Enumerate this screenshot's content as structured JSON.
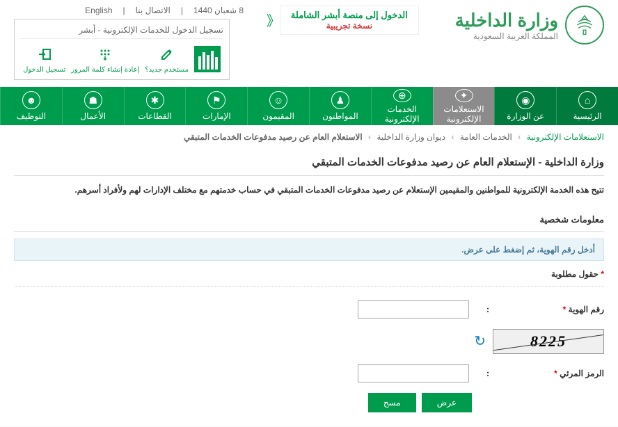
{
  "header": {
    "ministry_title": "وزارة الداخلية",
    "ministry_sub": "المملكة العربية السعودية",
    "banner_title": "الدخول إلى منصة أبشر الشاملة",
    "banner_sub": "نسخة تجريبية",
    "date_text": "8 شعبان 1440",
    "contact": "الاتصال بنا",
    "lang": "English"
  },
  "absher": {
    "title": "تسجيل الدخول للخدمات الإلكترونية - أبشر",
    "login": "تسجيل الدخول",
    "reset": "إعادة إنشاء كلمة المرور",
    "newuser": "مستخدم جديد؟"
  },
  "nav": {
    "home": "الرئيسية",
    "about": "عن الوزارة",
    "inquiry": "الاستعلامات الإلكترونية",
    "eservices": "الخدمات الإلكترونية",
    "citizens": "المواطنون",
    "residents": "المقيمون",
    "emirates": "الإمارات",
    "sectors": "القطاعات",
    "business": "الأعمال",
    "jobs": "التوظيف"
  },
  "breadcrumb": {
    "l1": "الاستعلامات الإلكترونية",
    "l2": "الخدمات العامة",
    "l3": "ديوان وزارة الداخلية",
    "l4": "الاستعلام العام عن رصيد مدفوعات الخدمات المتبقي"
  },
  "content": {
    "page_title": "وزارة الداخلية - الإستعلام العام عن رصيد مدفوعات الخدمات المتبقي",
    "desc": "تتيح هذه الخدمة الإلكترونية للمواطنين والمقيمين الإستعلام عن رصيد مدفوعات الخدمات المتبقي في حساب خدمتهم مع مختلف الإدارات لهم ولأفراد أسرهم.",
    "section": "معلومات شخصية",
    "info": "أدخل رقم الهوية، ثم إضغط على عرض.",
    "required": "حقول مطلوبة",
    "id_label": "رقم الهوية",
    "captcha_label": "الرمز المرئي",
    "captcha_value": "8225",
    "btn_view": "عرض",
    "btn_clear": "مسح"
  }
}
